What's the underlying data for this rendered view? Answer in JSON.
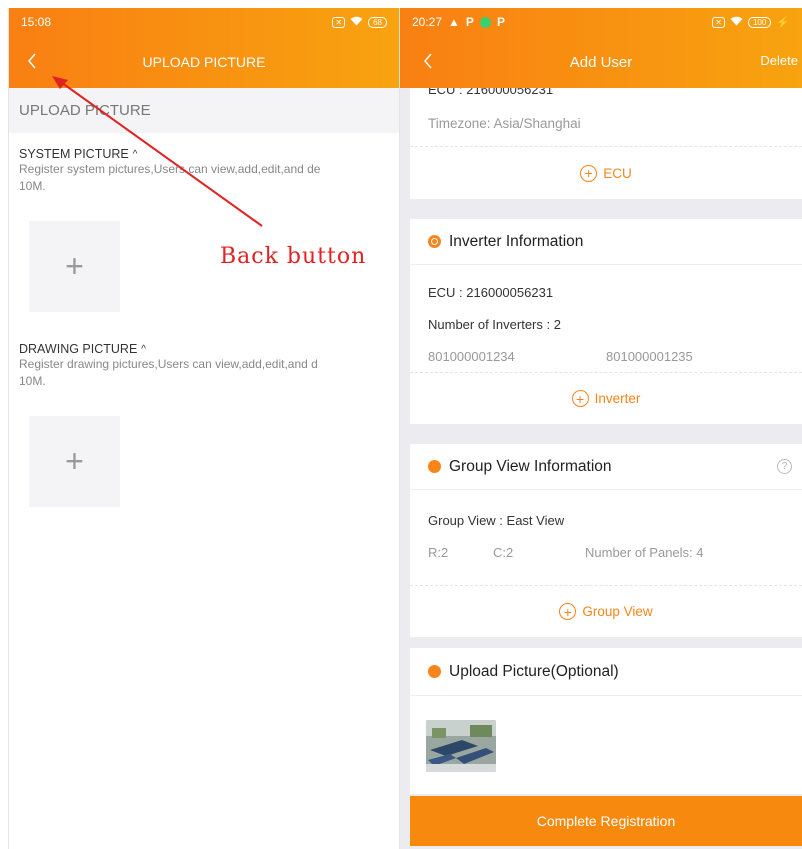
{
  "left_screen": {
    "status": {
      "time": "15:08",
      "battery": "68"
    },
    "title": "UPLOAD PICTURE",
    "section_header": "UPLOAD PICTURE",
    "system": {
      "title": "SYSTEM PICTURE",
      "description_line1": "Register system pictures,Users can view,add,edit,and de",
      "description_line2": "10M."
    },
    "drawing": {
      "title": "DRAWING PICTURE",
      "description_line1": "Register drawing pictures,Users can view,add,edit,and d",
      "description_line2": "10M."
    },
    "plus_symbol": "+"
  },
  "right_screen": {
    "status": {
      "time": "20:27",
      "battery": "100"
    },
    "title": "Add User",
    "delete_label": "Delete",
    "ecu_card": {
      "partial_ecu": "ECU : 216000056231",
      "timezone": "Timezone: Asia/Shanghai",
      "add_label": "ECU"
    },
    "inverter_card": {
      "title": "Inverter Information",
      "ecu": "ECU : 216000056231",
      "count": "Number of Inverters : 2",
      "inverters": [
        "801000001234",
        "801000001235"
      ],
      "add_label": "Inverter"
    },
    "group_card": {
      "title": "Group View Information",
      "help": "?",
      "group_view": "Group View : East View",
      "rows": "R:2",
      "cols": "C:2",
      "panels": "Number of Panels: 4",
      "add_label": "Group View"
    },
    "upload_card": {
      "title": "Upload Picture(Optional)"
    },
    "complete_label": "Complete Registration"
  },
  "annotation": {
    "label": "Back button"
  },
  "colors": {
    "accent": "#f7851a",
    "annotation": "#e02222"
  }
}
